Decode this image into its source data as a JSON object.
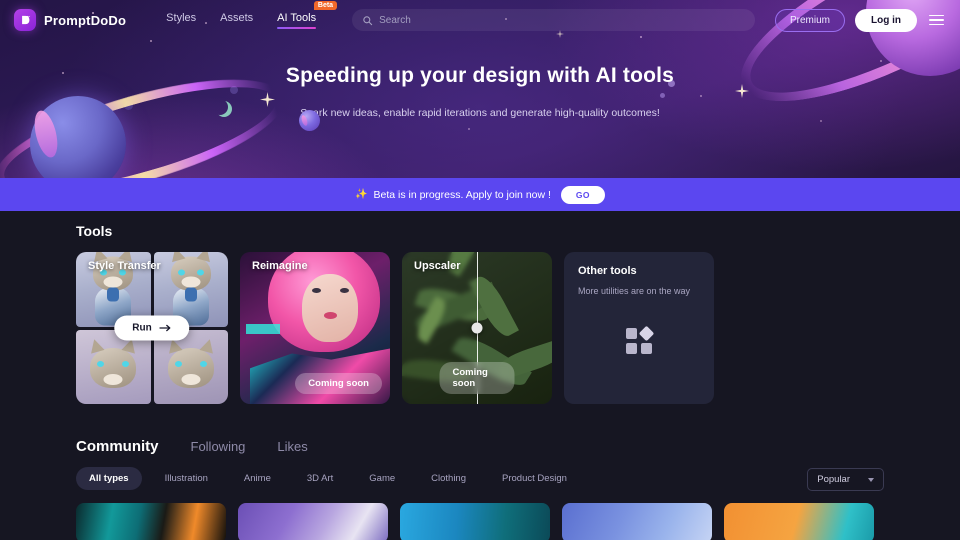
{
  "header": {
    "brand_name": "PromptDoDo",
    "logo_icon": "dodo-bird-logo-icon",
    "nav": [
      {
        "label": "Styles",
        "active": false,
        "badge": null
      },
      {
        "label": "Assets",
        "active": false,
        "badge": null
      },
      {
        "label": "AI Tools",
        "active": true,
        "badge": "Beta"
      }
    ],
    "search": {
      "placeholder": "Search",
      "value": "",
      "icon": "search-icon"
    },
    "premium_label": "Premium",
    "login_label": "Log in",
    "menu_icon": "hamburger-menu-icon"
  },
  "hero": {
    "title": "Speeding up your design with AI tools",
    "subtitle": "Spark new ideas, enable rapid iterations and generate high-quality outcomes!"
  },
  "banner": {
    "spark": "✨",
    "text": "Beta is in progress. Apply to join now !",
    "go_label": "GO",
    "color": "#5b47f0"
  },
  "tools": {
    "section_title": "Tools",
    "cards": [
      {
        "title": "Style Transfer",
        "action_label": "Run",
        "action_icon": "arrow-right-icon",
        "status": null
      },
      {
        "title": "Reimagine",
        "action_label": null,
        "status": "Coming soon"
      },
      {
        "title": "Upscaler",
        "action_label": null,
        "status": "Coming soon"
      },
      {
        "title": "Other tools",
        "subtitle": "More utilities are on the way",
        "icon": "apps-grid-icon",
        "status": null
      }
    ]
  },
  "community": {
    "tabs": [
      {
        "label": "Community",
        "active": true
      },
      {
        "label": "Following",
        "active": false
      },
      {
        "label": "Likes",
        "active": false
      }
    ],
    "filters": [
      {
        "label": "All types",
        "active": true
      },
      {
        "label": "Illustration",
        "active": false
      },
      {
        "label": "Anime",
        "active": false
      },
      {
        "label": "3D Art",
        "active": false
      },
      {
        "label": "Game",
        "active": false
      },
      {
        "label": "Clothing",
        "active": false
      },
      {
        "label": "Product Design",
        "active": false
      }
    ],
    "sort": {
      "value": "Popular",
      "icon": "chevron-down-icon"
    },
    "gallery": [
      {
        "accent": "#0f8f96"
      },
      {
        "accent": "#7a5fc4"
      },
      {
        "accent": "#1f8fd0"
      },
      {
        "accent": "#5a7fd8"
      },
      {
        "accent": "#f08a2a"
      }
    ]
  }
}
